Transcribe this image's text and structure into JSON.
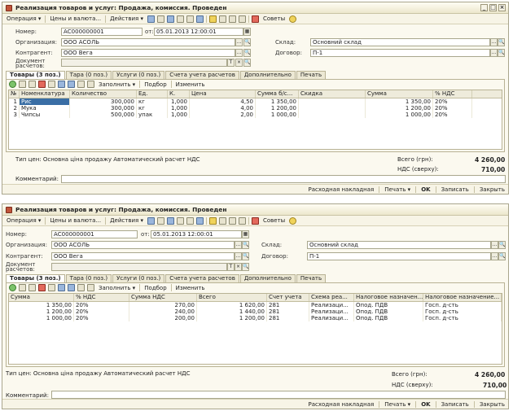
{
  "doc": {
    "title": "Реализация товаров и услуг: Продажа, комиссия. Проведен",
    "toolbar": {
      "operation": "Операция",
      "prices": "Цены и валюта...",
      "actions": "Действия",
      "advice": "Советы"
    },
    "labels": {
      "number": "Номер:",
      "from": "от:",
      "organization": "Организация:",
      "warehouse": "Склад:",
      "counterparty": "Контрагент:",
      "contract": "Договор:",
      "settlement_doc": "Документ расчетов:",
      "price_type": "Тип цен: Основна ціна продажу Автоматический расчет НДС",
      "total": "Всего (грн):",
      "vat_top": "НДС (сверху):",
      "comment": "Комментарий:"
    },
    "values": {
      "number": "АС000000001",
      "date": "05.01.2013 12:00:01",
      "organization": "ООО АСОЛЬ",
      "warehouse": "Основний склад",
      "counterparty": "ООО Вега",
      "contract": "П-1",
      "total": "4 260,00",
      "vat": "710,00"
    },
    "tabs": [
      "Товары (3 поз.)",
      "Тара (0 поз.)",
      "Услуги (0 поз.)",
      "Счета учета расчетов",
      "Дополнительно",
      "Печать"
    ],
    "tab_tools": {
      "fill": "Заполнить",
      "selection": "Подбор",
      "change": "Изменить"
    },
    "bottom": {
      "invoice": "Расходная накладная",
      "print": "Печать",
      "ok": "OK",
      "save": "Записать",
      "close": "Закрыть"
    }
  },
  "grid1": {
    "headers": [
      "№",
      "Номенклатура",
      "Количество",
      "Ед.",
      "К.",
      "Цена",
      "Сумма б/с...",
      "Скидка",
      "Сумма",
      "% НДС"
    ],
    "rows": [
      [
        "1",
        "Рис",
        "300,000",
        "кг",
        "1,000",
        "4,50",
        "1 350,00",
        "",
        "1 350,00",
        "20%"
      ],
      [
        "2",
        "Мука",
        "300,000",
        "кг",
        "1,000",
        "4,00",
        "1 200,00",
        "",
        "1 200,00",
        "20%"
      ],
      [
        "3",
        "Чипсы",
        "500,000",
        "упак",
        "1,000",
        "2,00",
        "1 000,00",
        "",
        "1 000,00",
        "20%"
      ]
    ]
  },
  "grid2": {
    "headers": [
      "Сумма",
      "% НДС",
      "Сумма НДС",
      "Всего",
      "Счет учета",
      "Схема реа...",
      "Налоговое назначен...",
      "Налоговое назначение..."
    ],
    "rows": [
      [
        "1 350,00",
        "20%",
        "270,00",
        "1 620,00",
        "281",
        "Реализаци...",
        "Опод. ПДВ",
        "Госп. д-сть"
      ],
      [
        "1 200,00",
        "20%",
        "240,00",
        "1 440,00",
        "281",
        "Реализаци...",
        "Опод. ПДВ",
        "Госп. д-сть"
      ],
      [
        "1 000,00",
        "20%",
        "200,00",
        "1 200,00",
        "281",
        "Реализаци...",
        "Опод. ПДВ",
        "Госп. д-сть"
      ]
    ]
  }
}
